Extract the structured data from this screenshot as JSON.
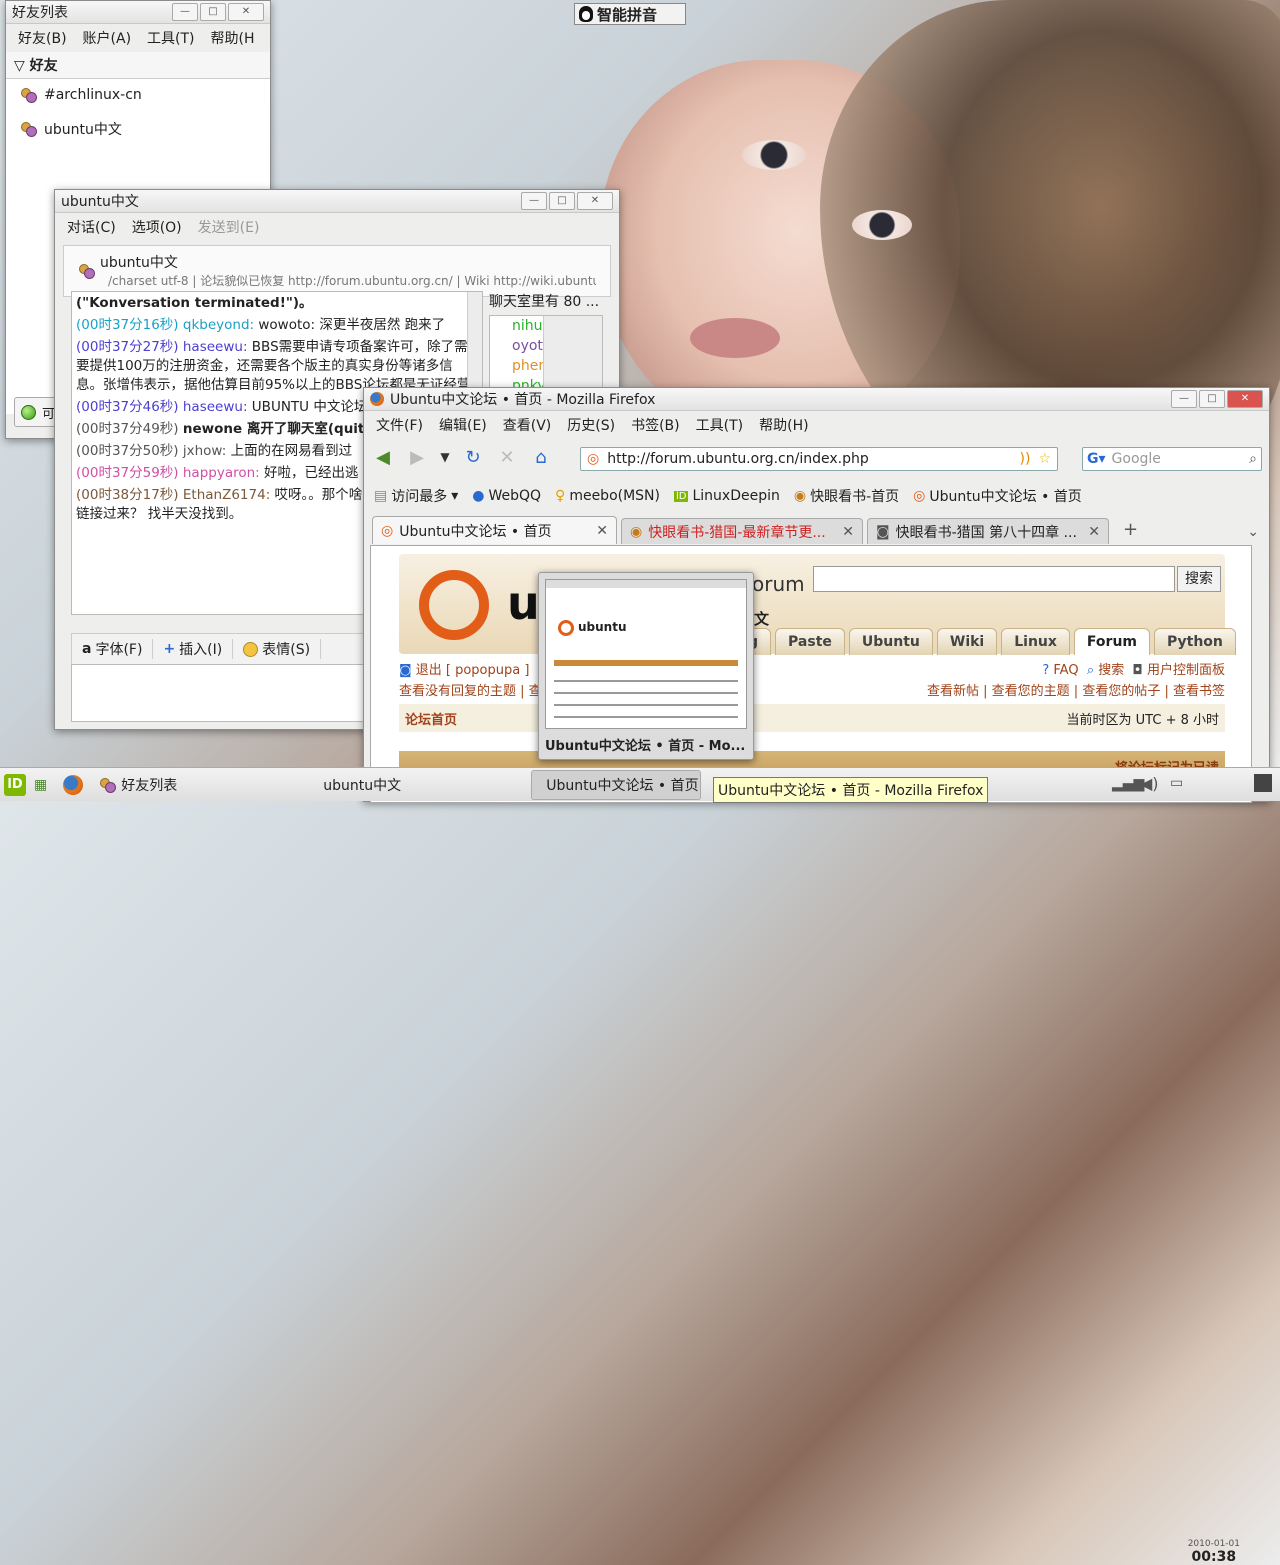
{
  "ime": {
    "label": "智能拼音"
  },
  "friends_window": {
    "title": "好友列表",
    "menu": [
      "好友(B)",
      "账户(A)",
      "工具(T)",
      "帮助(H"
    ],
    "group": "好友",
    "items": [
      "#archlinux-cn",
      "ubuntu中文"
    ],
    "status_label": "可"
  },
  "chat_window": {
    "title": "ubuntu中文",
    "menu": [
      "对话(C)",
      "选项(O)",
      "发送到(E)"
    ],
    "room_name": "ubuntu中文",
    "topic": "/charset utf-8 | 论坛貌似已恢复 http://forum.ubuntu.org.cn/ | Wiki http://wiki.ubuntu...",
    "users_label": "聊天室里有 80 ...",
    "users": [
      "nihui",
      "oyotata...",
      "pheno...",
      "pnkyor"
    ],
    "messages": [
      {
        "ts": "",
        "nick": "",
        "text": "(\"Konversation terminated!\")。"
      },
      {
        "ts": "(00时37分16秒)",
        "nick": "qkbeyond:",
        "text": "wowoto: 深更半夜居然 跑来了"
      },
      {
        "ts": "(00时37分27秒)",
        "nick": "haseewu:",
        "text": "BBS需要申请专项备案许可，除了需要提供100万的注册资金，还需要各个版主的真实身份等诸多信息。张增伟表示，据他估算目前95%以上的BBS论坛都是无证经营"
      },
      {
        "ts": "(00时37分46秒)",
        "nick": "haseewu:",
        "text": "UBUNTU 中文论坛 去了."
      },
      {
        "ts": "(00时37分49秒)",
        "nick": "",
        "text": "newone 离开了聊天室(quit: closed\")。"
      },
      {
        "ts": "(00时37分50秒)",
        "nick": "jxhow:",
        "text": "上面的在网易看到过"
      },
      {
        "ts": "(00时37分59秒)",
        "nick": "happyaron:",
        "text": "好啦，已经出逃 那些东西啦"
      },
      {
        "ts": "(00时38分17秒)",
        "nick": "EthanZ6174:",
        "text": "哎呀。。那个啥 呢？ 谁给我丢个链接过来？ 找半天没找到。"
      }
    ],
    "toolbar": [
      "字体(F)",
      "插入(I)",
      "表情(S)"
    ]
  },
  "firefox": {
    "title": "Ubuntu中文论坛 • 首页 - Mozilla Firefox",
    "menu": [
      "文件(F)",
      "编辑(E)",
      "查看(V)",
      "历史(S)",
      "书签(B)",
      "工具(T)",
      "帮助(H)"
    ],
    "url": "http://forum.ubuntu.org.cn/index.php",
    "search_placeholder": "Google",
    "bookmarks": [
      "访问最多",
      "WebQQ",
      "meebo(MSN)",
      "LinuxDeepin",
      "快眼看书-首页",
      "Ubuntu中文论坛 • 首页"
    ],
    "tabs": [
      "Ubuntu中文论坛 • 首页",
      "快眼看书-猎国-最新章节更...",
      "快眼看书-猎国 第八十四章 ..."
    ],
    "page": {
      "logo_text": "ubuntu",
      "forum_label": "forum",
      "subtitle": "中文",
      "search_button": "搜索",
      "nav_tabs": [
        "g",
        "Paste",
        "Ubuntu",
        "Wiki",
        "Linux",
        "Forum",
        "Python"
      ],
      "links_left": "退出 [ popopupa ]",
      "links_right": [
        "FAQ",
        "搜索",
        "用户控制面板"
      ],
      "links2_left": [
        "查看没有回复的主题",
        "查"
      ],
      "links2_right": [
        "查看新帖",
        "查看您的主题",
        "查看您的帖子",
        "查看书签"
      ],
      "band_left": "论坛首页",
      "band_right": "当前时区为 UTC + 8 小时",
      "bottom_text": "将论坛标记为已读"
    }
  },
  "thumbnail": {
    "caption": "Ubuntu中文论坛 • 首页 - Mo..."
  },
  "taskbar": {
    "items": [
      "好友列表",
      "ubuntu中文",
      "Ubuntu中文论坛 • 首页"
    ],
    "tooltip": "Ubuntu中文论坛 • 首页 - Mozilla Firefox",
    "date": "2010-01-01",
    "time": "00:38"
  }
}
